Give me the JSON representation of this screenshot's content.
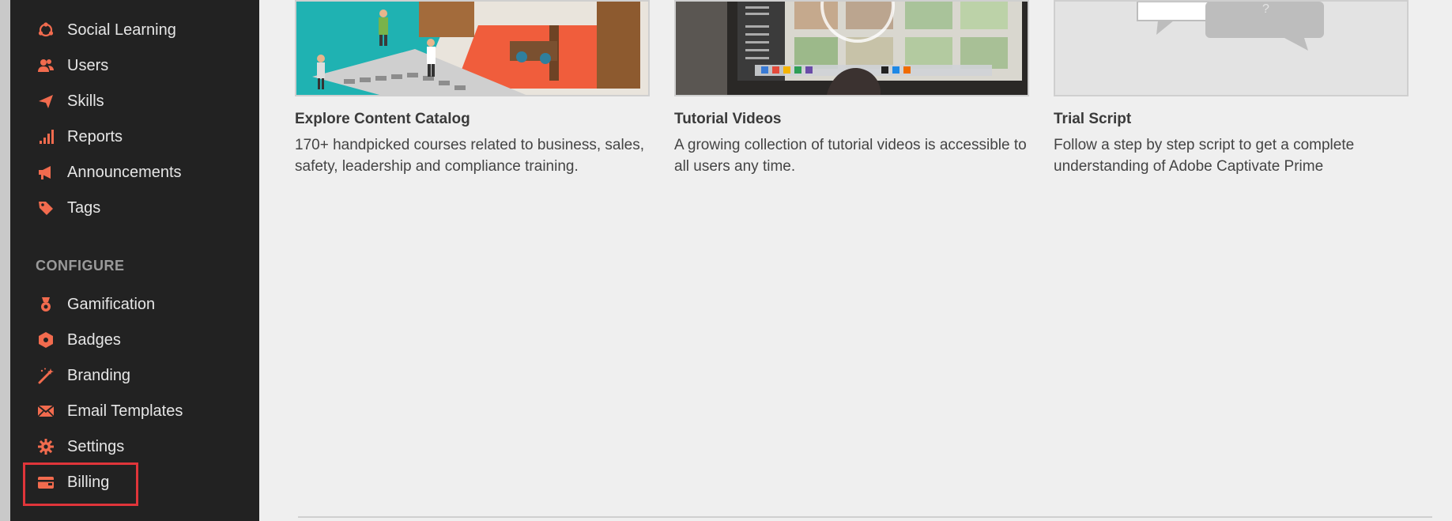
{
  "sidebar": {
    "items_top": [
      {
        "label": "Social Learning",
        "icon": "social-learning-icon"
      },
      {
        "label": "Users",
        "icon": "users-icon"
      },
      {
        "label": "Skills",
        "icon": "skills-icon"
      },
      {
        "label": "Reports",
        "icon": "reports-icon"
      },
      {
        "label": "Announcements",
        "icon": "megaphone-icon"
      },
      {
        "label": "Tags",
        "icon": "tag-icon"
      }
    ],
    "configure_title": "CONFIGURE",
    "items_configure": [
      {
        "label": "Gamification",
        "icon": "medal-icon"
      },
      {
        "label": "Badges",
        "icon": "badge-icon"
      },
      {
        "label": "Branding",
        "icon": "magic-wand-icon"
      },
      {
        "label": "Email Templates",
        "icon": "email-icon"
      },
      {
        "label": "Settings",
        "icon": "gear-icon"
      },
      {
        "label": "Billing",
        "icon": "wallet-icon"
      }
    ],
    "selected": "Billing"
  },
  "cards": [
    {
      "title": "Explore Content Catalog",
      "description": "170+ handpicked courses related to business, sales, safety, leadership and compliance training."
    },
    {
      "title": "Tutorial Videos",
      "description": "A growing collection of tutorial videos is accessible to all users any time."
    },
    {
      "title": "Trial Script",
      "description": "Follow a step by step script to get a complete understanding of Adobe Captivate Prime"
    }
  ],
  "colors": {
    "accent": "#f26b4e",
    "sidebar_bg": "#222222",
    "highlight": "#e0353a",
    "content_bg": "#efefef"
  }
}
